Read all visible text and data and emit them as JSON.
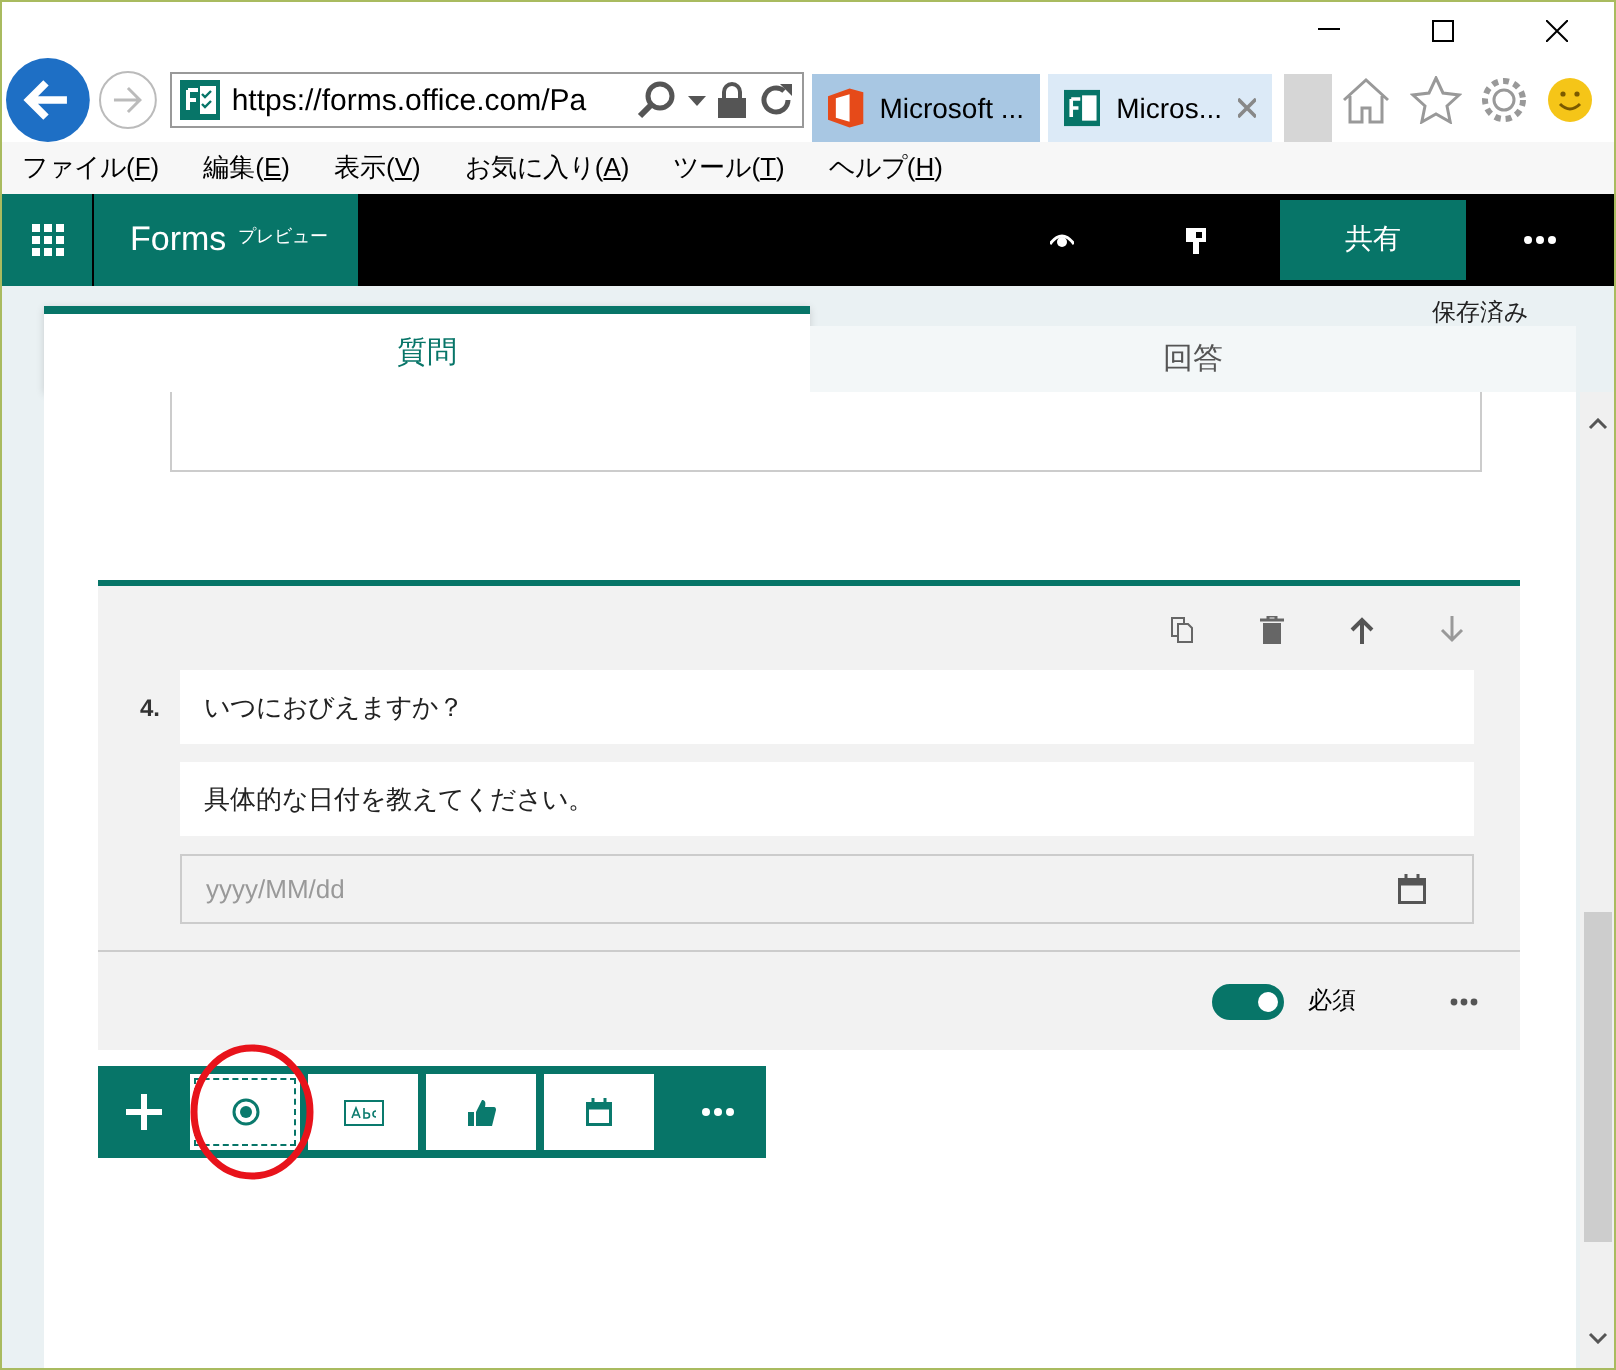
{
  "browser": {
    "address": {
      "url": "https://forms.office.com/Pa"
    },
    "tabs": [
      {
        "label": "Microsoft ...",
        "selected": false,
        "kind": "office"
      },
      {
        "label": "Micros...",
        "selected": true,
        "kind": "forms"
      }
    ],
    "menu": [
      {
        "before": "ファイル(",
        "key": "F",
        "after": ")"
      },
      {
        "before": "編集(",
        "key": "E",
        "after": ")"
      },
      {
        "before": "表示(",
        "key": "V",
        "after": ")"
      },
      {
        "before": "お気に入り(",
        "key": "A",
        "after": ")"
      },
      {
        "before": "ツール(",
        "key": "T",
        "after": ")"
      },
      {
        "before": "ヘルプ(",
        "key": "H",
        "after": ")"
      }
    ]
  },
  "app_bar": {
    "title": "Forms",
    "badge": "プレビュー",
    "share_button": "共有"
  },
  "tabs": [
    {
      "label": "質問",
      "selected": true
    },
    {
      "label": "回答",
      "selected": false
    }
  ],
  "save_status": "保存済み",
  "question": {
    "number": "4.",
    "title": "いつにおびえますか？",
    "subtitle": "具体的な日付を教えてください。",
    "date_field": {
      "placeholder": "yyyy/MM/dd"
    },
    "required": {
      "label": "必須",
      "on": true
    }
  },
  "add_toolbar": {
    "buttons": [
      {
        "kind": "choice",
        "selected": true
      },
      {
        "kind": "text",
        "selected": false
      },
      {
        "kind": "rating",
        "selected": false
      },
      {
        "kind": "date",
        "selected": false
      }
    ]
  }
}
